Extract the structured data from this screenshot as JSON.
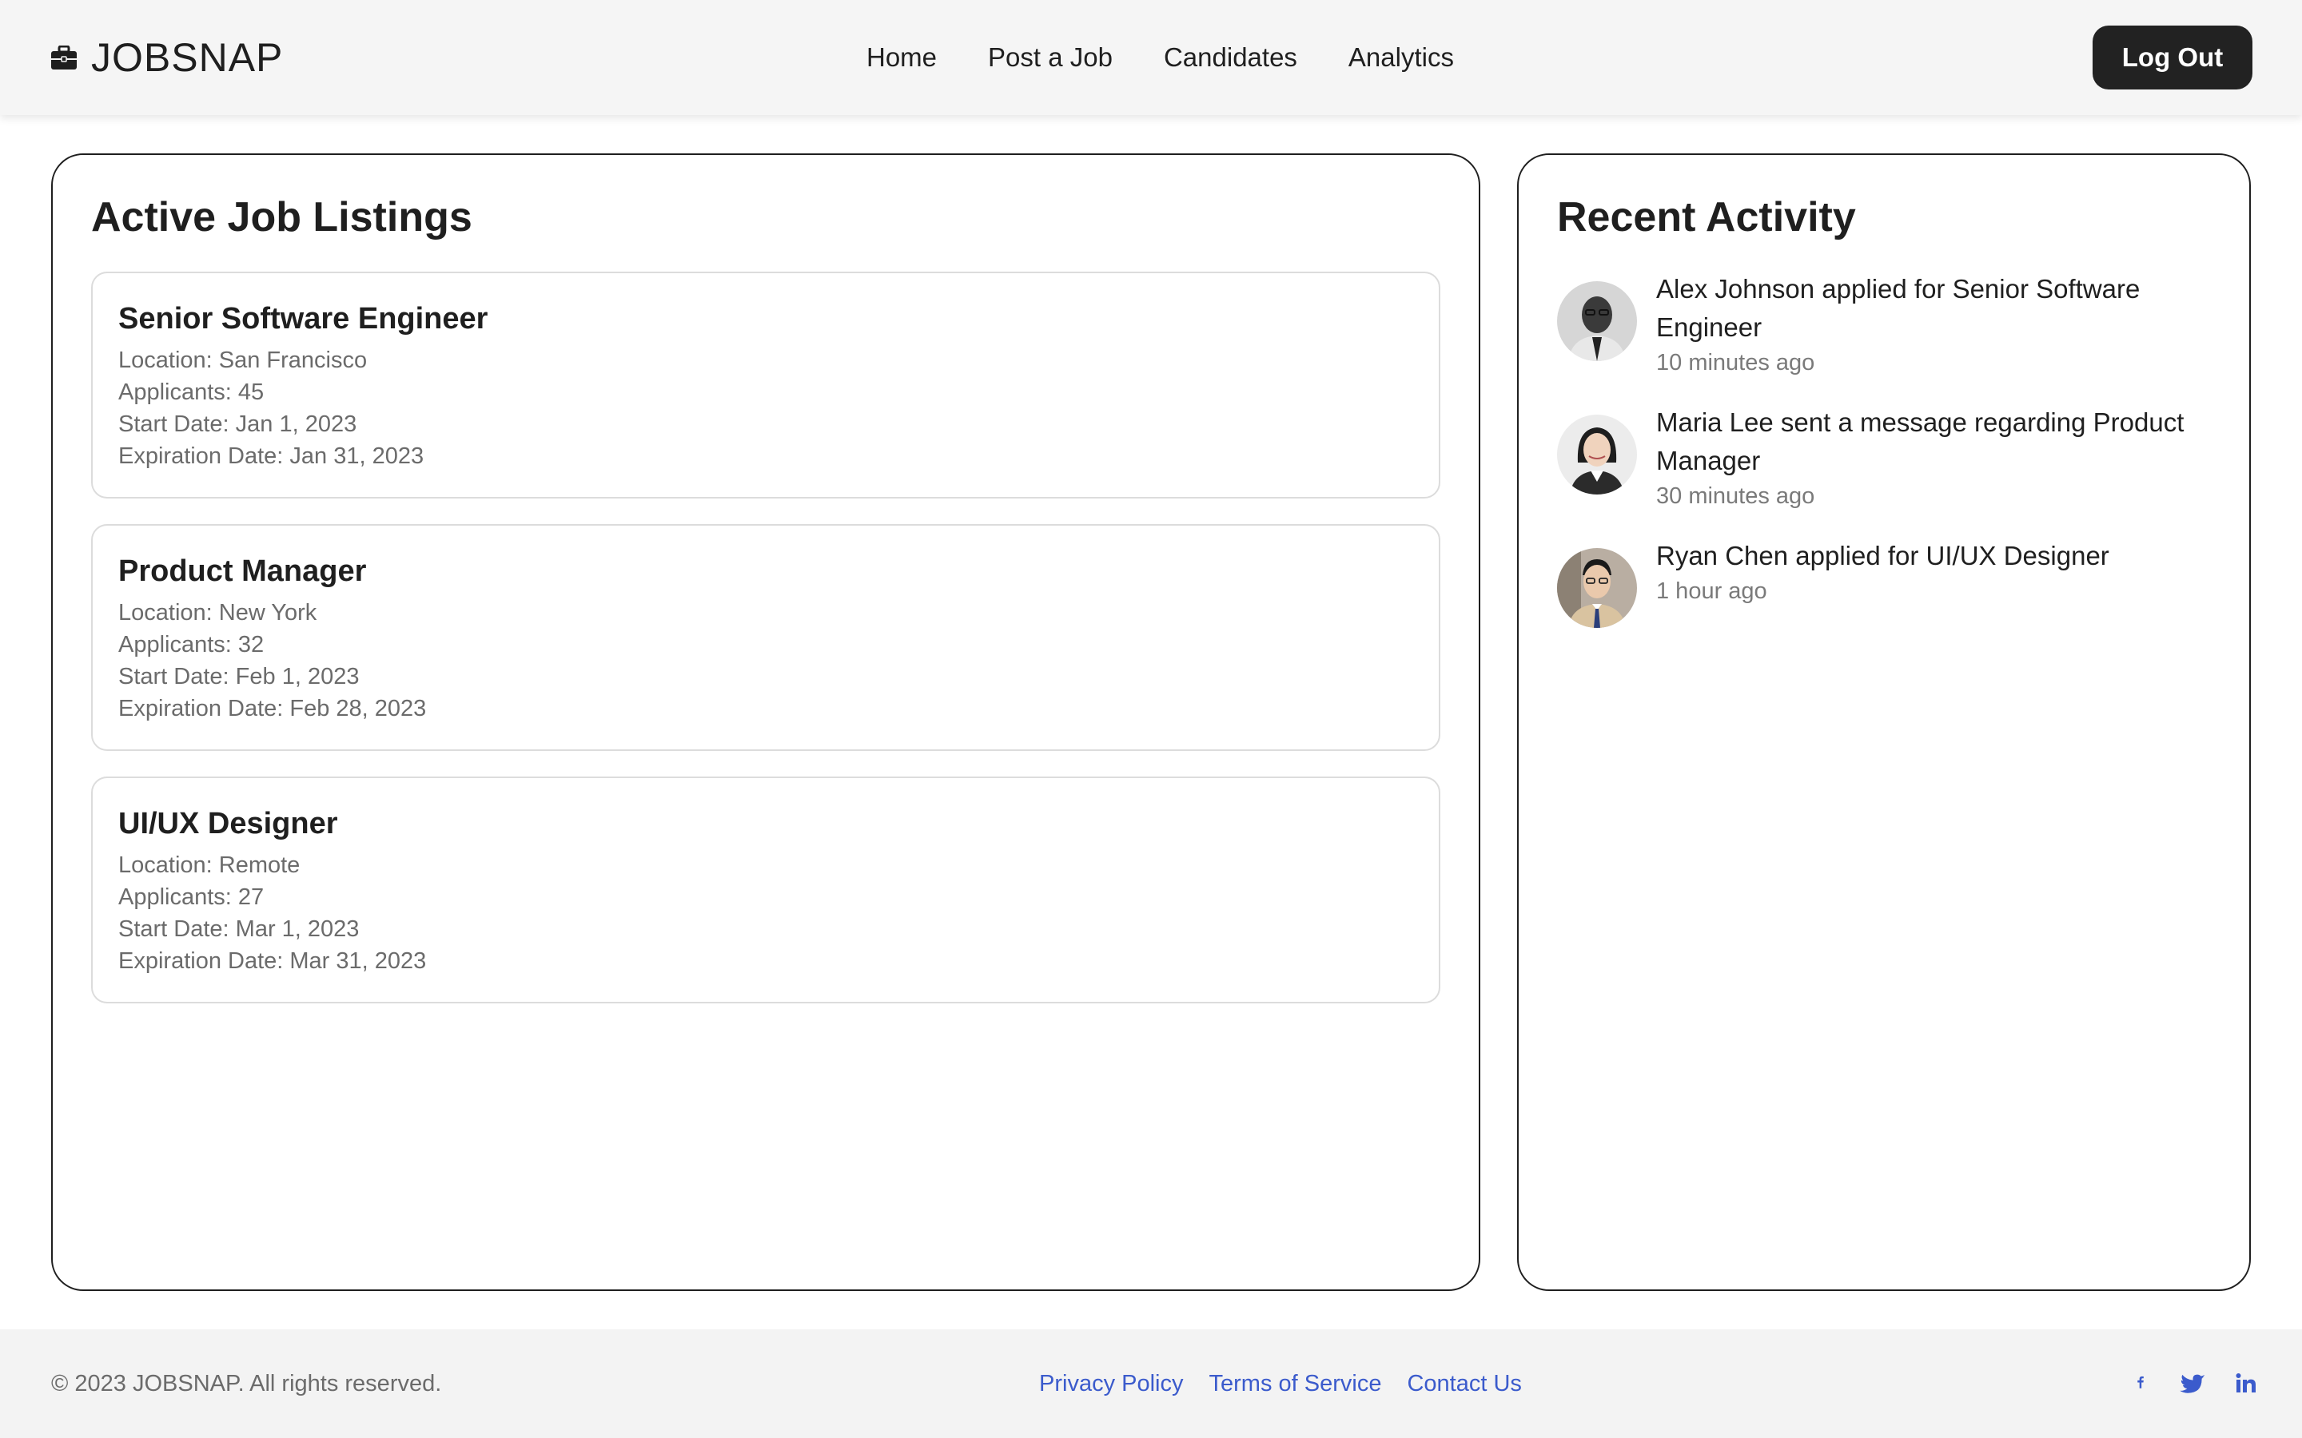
{
  "header": {
    "brand": "JOBSNAP",
    "brand_icon": "briefcase-icon",
    "nav": [
      {
        "label": "Home"
      },
      {
        "label": "Post a Job"
      },
      {
        "label": "Candidates"
      },
      {
        "label": "Analytics"
      }
    ],
    "logout_label": "Log Out"
  },
  "listings": {
    "title": "Active Job Listings",
    "jobs": [
      {
        "title": "Senior Software Engineer",
        "location": "Location: San Francisco",
        "applicants": "Applicants: 45",
        "start": "Start Date: Jan 1, 2023",
        "expiration": "Expiration Date: Jan 31, 2023"
      },
      {
        "title": "Product Manager",
        "location": "Location: New York",
        "applicants": "Applicants: 32",
        "start": "Start Date: Feb 1, 2023",
        "expiration": "Expiration Date: Feb 28, 2023"
      },
      {
        "title": "UI/UX Designer",
        "location": "Location: Remote",
        "applicants": "Applicants: 27",
        "start": "Start Date: Mar 1, 2023",
        "expiration": "Expiration Date: Mar 31, 2023"
      }
    ]
  },
  "activity": {
    "title": "Recent Activity",
    "items": [
      {
        "text": "Alex Johnson applied for Senior Software Engineer",
        "time": "10 minutes ago"
      },
      {
        "text": "Maria Lee sent a message regarding Product Manager",
        "time": "30 minutes ago"
      },
      {
        "text": "Ryan Chen applied for UI/UX Designer",
        "time": "1 hour ago"
      }
    ]
  },
  "footer": {
    "copyright": "© 2023 JOBSNAP. All rights reserved.",
    "links": [
      {
        "label": "Privacy Policy"
      },
      {
        "label": "Terms of Service"
      },
      {
        "label": "Contact Us"
      }
    ],
    "social_icons": [
      "facebook-icon",
      "twitter-icon",
      "linkedin-icon"
    ]
  },
  "colors": {
    "accent_link": "#3b5bcc",
    "dark_button": "#222222",
    "header_bg": "#f5f5f5"
  }
}
